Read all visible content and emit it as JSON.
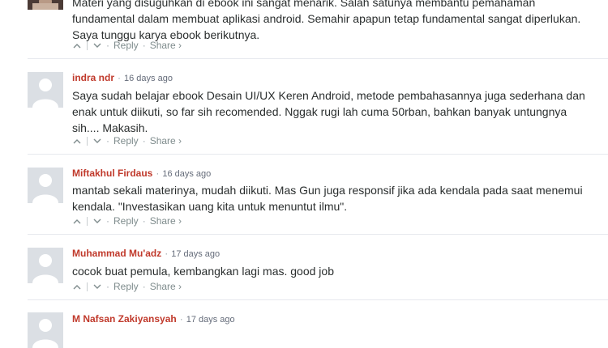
{
  "thread": {
    "top_comment": {
      "lines": [
        "Materi yang disuguhkan di ebook ini sangat menarik. Salah satunya membantu pemahaman",
        "fundamental dalam membuat aplikasi android. Semahir apapun tetap fundamental sangat diperlukan.",
        "Saya tunggu karya ebook berikutnya."
      ],
      "reply_label": "Reply",
      "share_label": "Share ›"
    },
    "comments": [
      {
        "author": "indra ndr",
        "time": "16 days ago",
        "lines": [
          "Saya sudah belajar ebook Desain UI/UX Keren Android, metode pembahasannya juga sederhana dan",
          "enak untuk diikuti, so far sih recomended. Nggak rugi lah cuma 50rban, bahkan banyak untungnya",
          "sih.... Makasih."
        ],
        "reply_label": "Reply",
        "share_label": "Share ›"
      },
      {
        "author": "Miftakhul Firdaus",
        "time": "16 days ago",
        "lines": [
          "mantab sekali materinya, mudah diikuti. Mas Gun juga responsif jika ada kendala pada saat menemui",
          "kendala. \"Investasikan uang kita untuk menuntut ilmu\"."
        ],
        "reply_label": "Reply",
        "share_label": "Share ›"
      },
      {
        "author": "Muhammad Mu'adz",
        "time": "17 days ago",
        "lines": [
          "cocok buat pemula, kembangkan lagi mas. good job"
        ],
        "reply_label": "Reply",
        "share_label": "Share ›"
      },
      {
        "author": "M Nafsan Zakiyansyah",
        "time": "17 days ago",
        "lines": [],
        "reply_label": "",
        "share_label": ""
      }
    ],
    "separator": "·",
    "icons": {
      "upvote": "chevron-up-icon",
      "downvote": "chevron-down-icon",
      "default_avatar": "default-avatar-icon"
    },
    "colors": {
      "author": "#c0392b",
      "meta": "#656c7a",
      "action": "#7f8c8d",
      "text": "#2a2e2e",
      "avatar_bg": "#dbdfe4",
      "avatar_fg": "#ffffff",
      "divider": "#e7e9ee"
    }
  }
}
